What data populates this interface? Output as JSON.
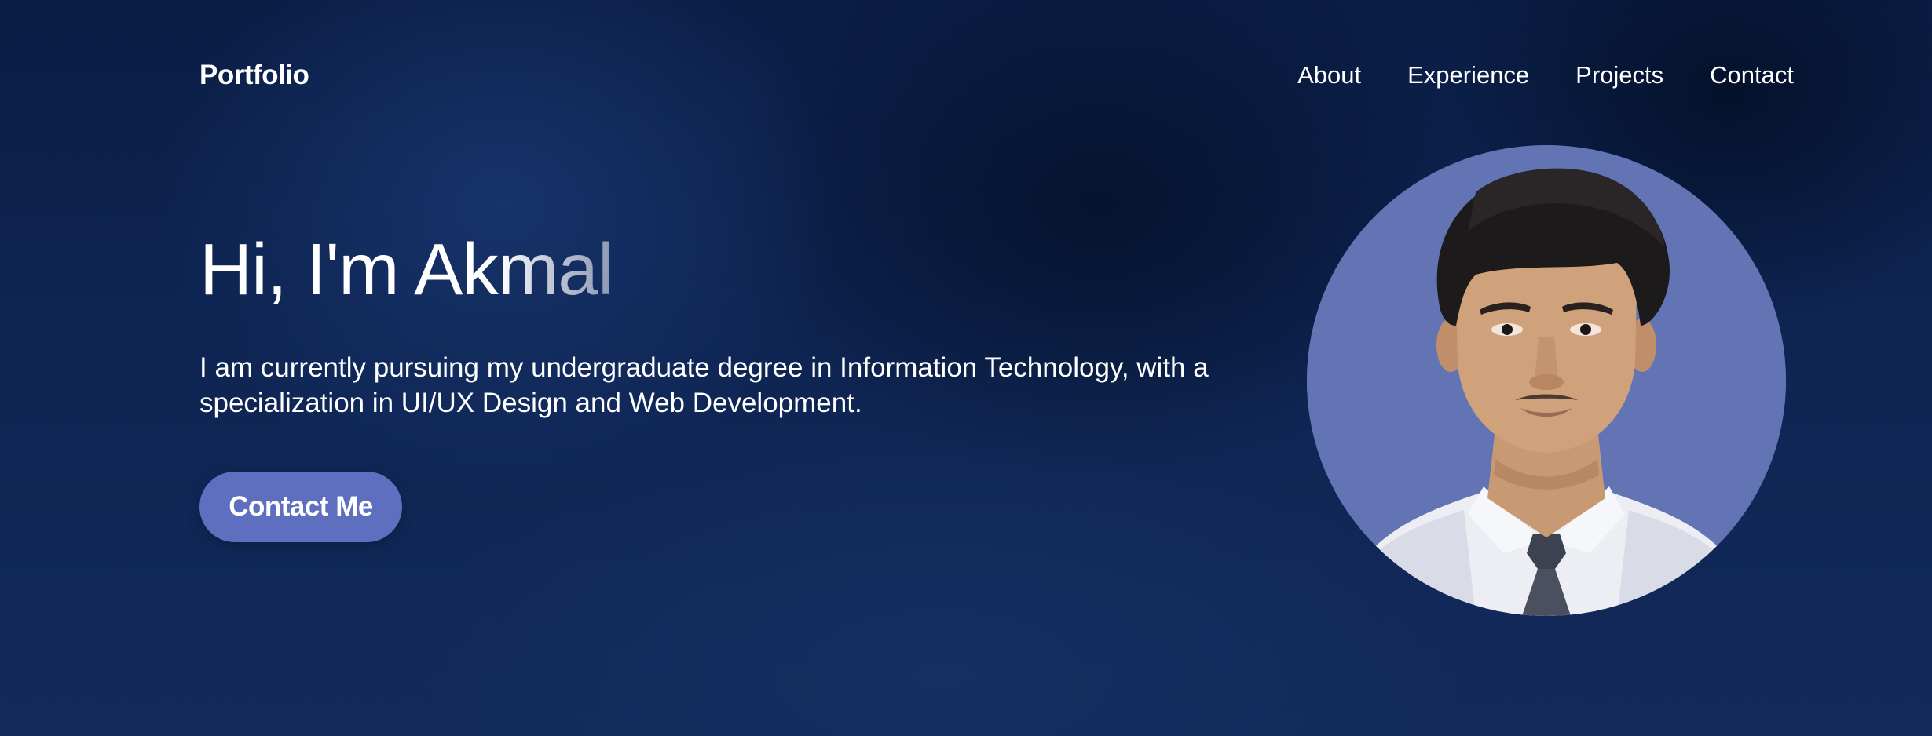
{
  "nav": {
    "brand": "Portfolio",
    "links": [
      {
        "label": "About"
      },
      {
        "label": "Experience"
      },
      {
        "label": "Projects"
      },
      {
        "label": "Contact"
      }
    ]
  },
  "hero": {
    "title_solid": "Hi, I'm Ak",
    "title_fade": "mal",
    "description": "I am currently pursuing my undergraduate degree in Information Technology, with a specialization in UI/UX Design and Web Development.",
    "cta_label": "Contact Me"
  },
  "colors": {
    "accent": "#5e6fc0",
    "avatar_bg": "#6374b4",
    "background": "#0f2655"
  }
}
